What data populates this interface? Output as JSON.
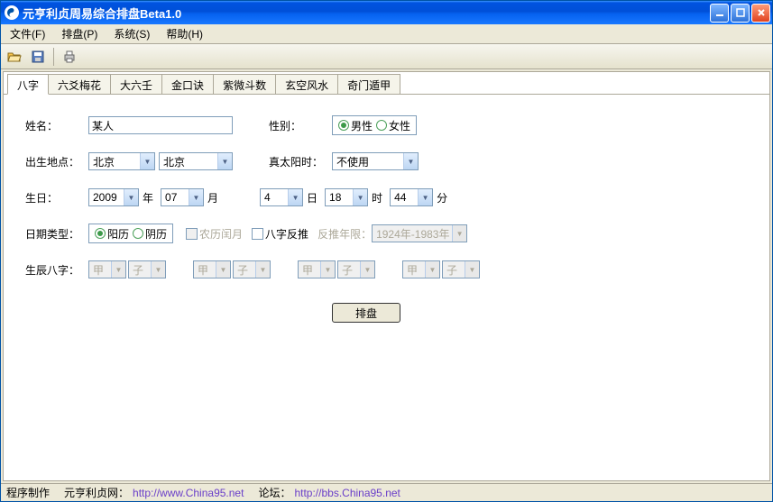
{
  "titlebar": {
    "text": "元亨利贞周易综合排盘Beta1.0"
  },
  "menu": {
    "file": "文件(F)",
    "paipan": "排盘(P)",
    "system": "系统(S)",
    "help": "帮助(H)"
  },
  "tabs": [
    "八字",
    "六爻梅花",
    "大六壬",
    "金口诀",
    "紫微斗数",
    "玄空风水",
    "奇门遁甲"
  ],
  "form": {
    "name_label": "姓名：",
    "name_value": "某人",
    "gender_label": "性别：",
    "gender_male": "男性",
    "gender_female": "女性",
    "birthplace_label": "出生地点：",
    "province": "北京",
    "city": "北京",
    "truesun_label": "真太阳时：",
    "truesun_value": "不使用",
    "birthday_label": "生日：",
    "year": "2009",
    "year_unit": "年",
    "month": "07",
    "month_unit": "月",
    "day": "4",
    "day_unit": "日",
    "hour": "18",
    "hour_unit": "时",
    "minute": "44",
    "minute_unit": "分",
    "datetype_label": "日期类型：",
    "solar": "阳历",
    "lunar": "阴历",
    "leap": "农历闰月",
    "reverse": "八字反推",
    "reverse_range_label": "反推年限：",
    "reverse_range": "1924年-1983年",
    "bazi_label": "生辰八字：",
    "stem": "甲",
    "branch": "子",
    "submit": "排盘"
  },
  "status": {
    "maker_label": "程序制作",
    "site_label": "元亨利贞网：",
    "site_url": "http://www.China95.net",
    "bbs_label": "论坛：",
    "bbs_url": "http://bbs.China95.net"
  }
}
